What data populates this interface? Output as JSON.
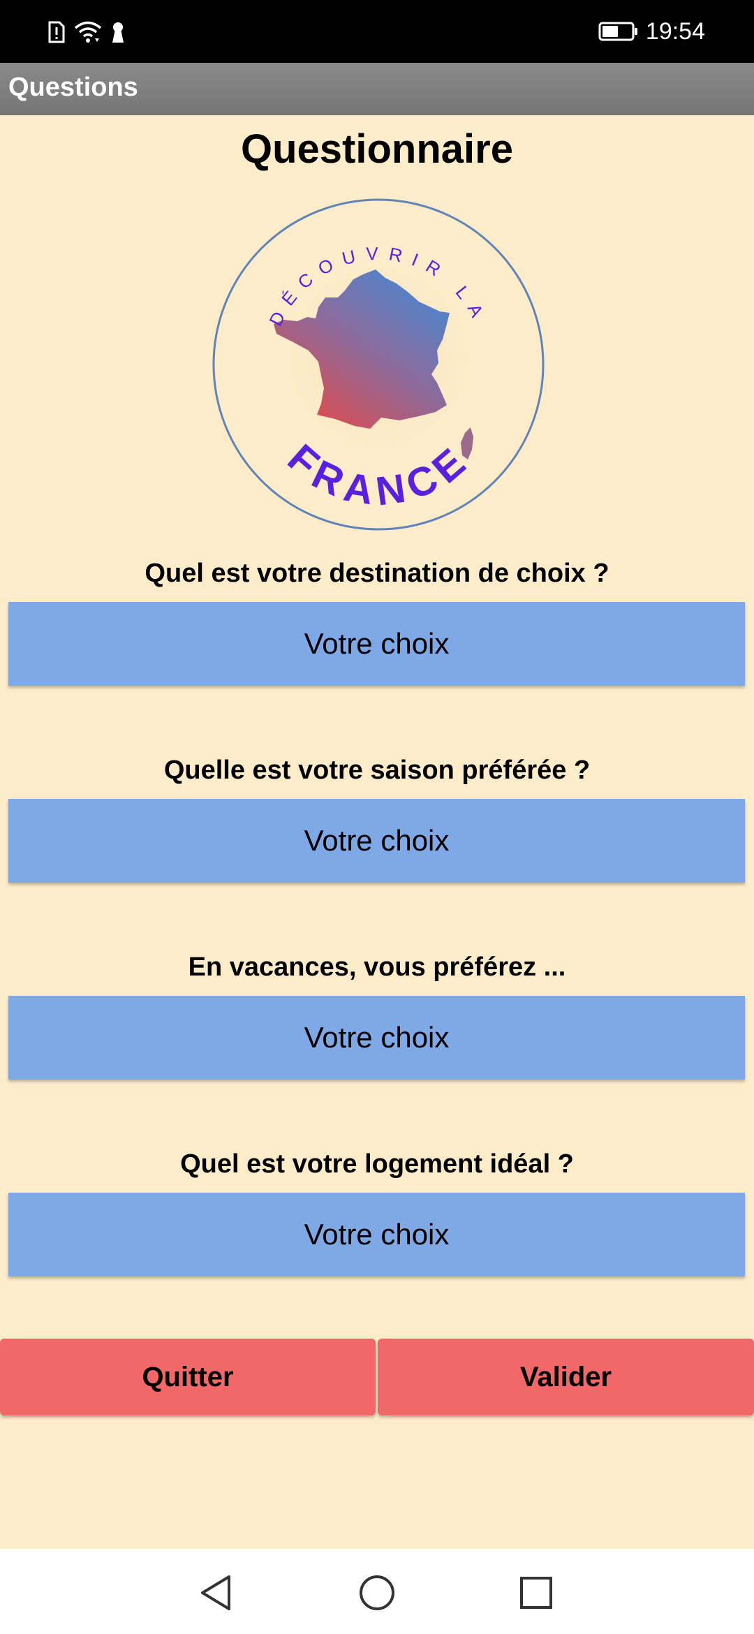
{
  "status_bar": {
    "time": "19:54",
    "icons": [
      "sim-alert-icon",
      "wifi-icon",
      "keyhole-icon",
      "battery-icon"
    ]
  },
  "app_bar": {
    "title": "Questions"
  },
  "page": {
    "title": "Questionnaire"
  },
  "logo": {
    "arc_text": "DÉCOUVRIR LA",
    "main_text": "FRANCE"
  },
  "questions": [
    {
      "label": "Quel est votre destination de choix ?",
      "button": "Votre choix"
    },
    {
      "label": "Quelle est votre saison préférée ?",
      "button": "Votre choix"
    },
    {
      "label": "En vacances, vous préférez ...",
      "button": "Votre choix"
    },
    {
      "label": "Quel est votre logement idéal ?",
      "button": "Votre choix"
    }
  ],
  "actions": {
    "quit": "Quitter",
    "validate": "Valider"
  },
  "nav_bar": {
    "icons": [
      "back-icon",
      "home-icon",
      "recents-icon"
    ]
  },
  "colors": {
    "background": "#fdecc9",
    "choice_button": "#7ea9e6",
    "action_button": "#f26868",
    "app_bar": "#808080",
    "logo_text": "#5b1fe0"
  }
}
